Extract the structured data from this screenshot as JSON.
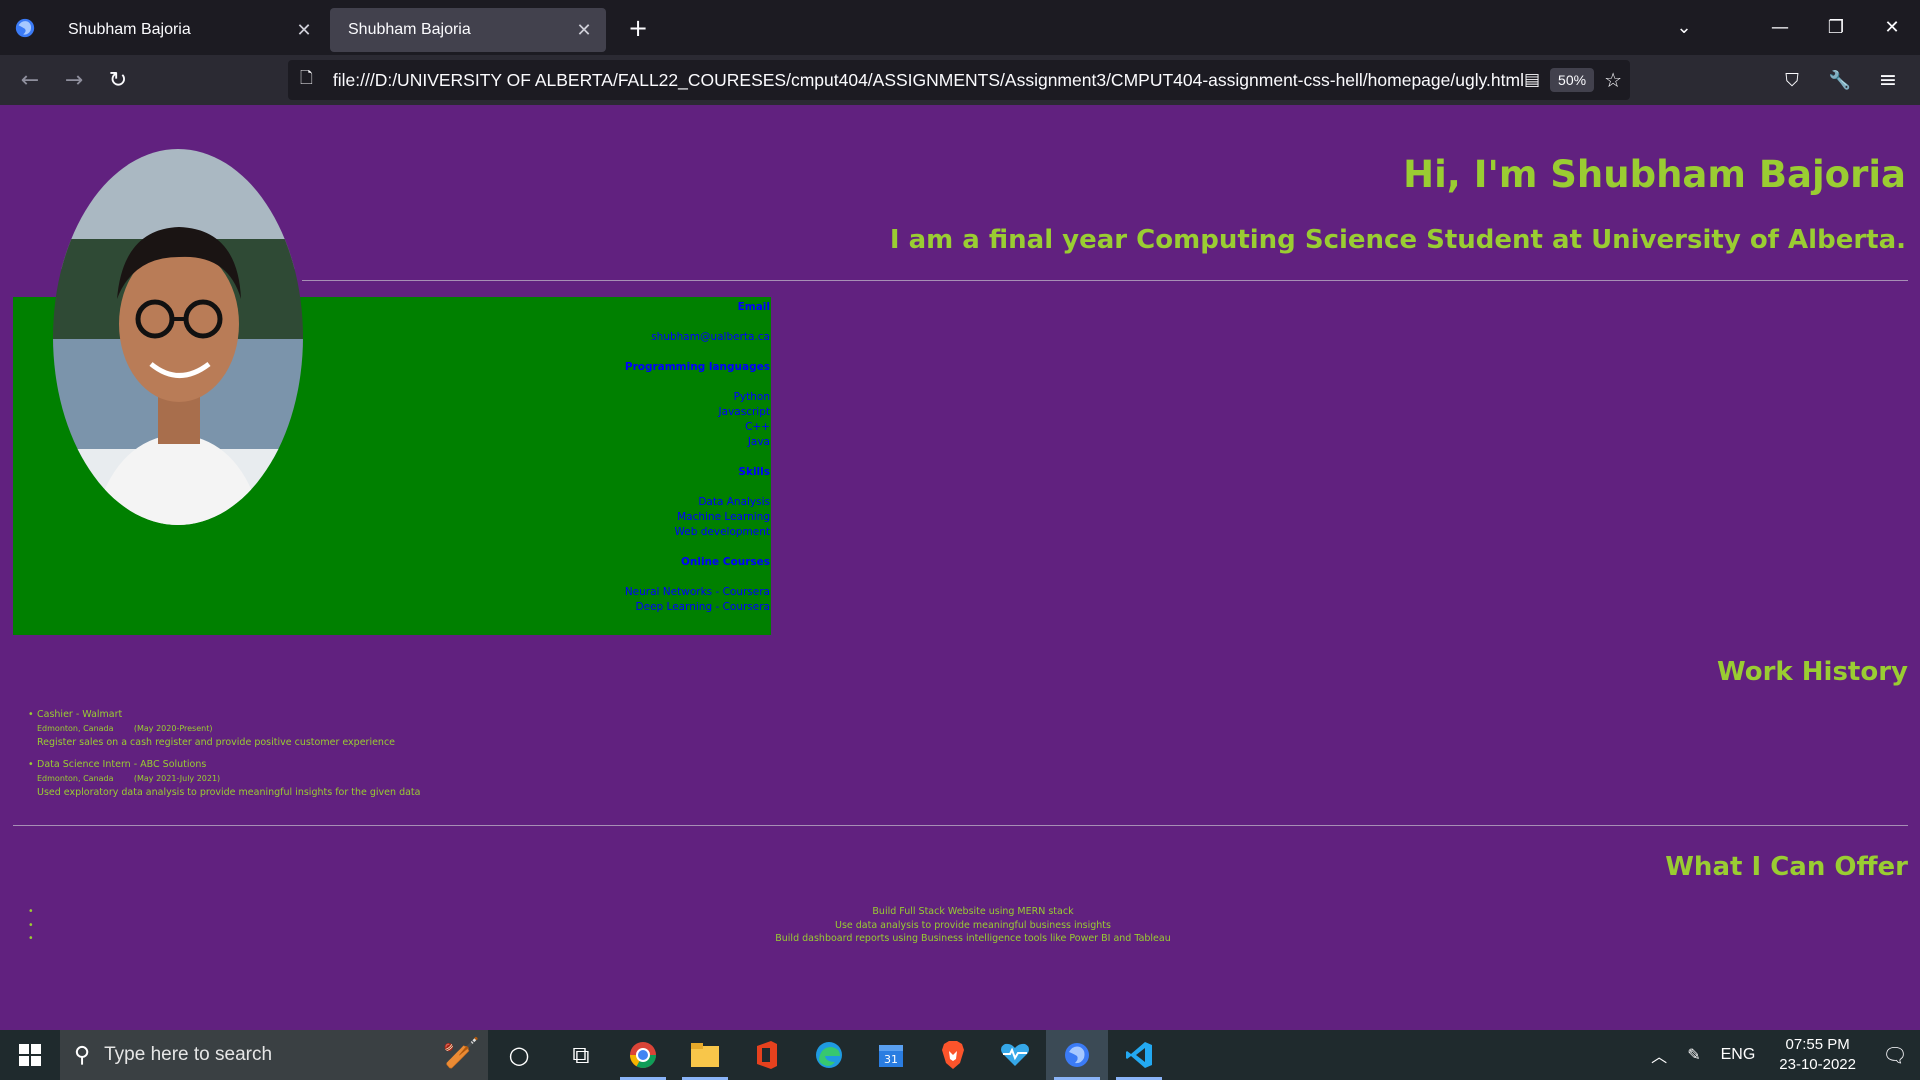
{
  "browser": {
    "tabs": [
      {
        "title": "Shubham Bajoria",
        "active": false
      },
      {
        "title": "Shubham Bajoria",
        "active": true
      }
    ],
    "url": "file:///D:/UNIVERSITY OF ALBERTA/FALL22_COURESES/cmput404/ASSIGNMENTS/Assignment3/CMPUT404-assignment-css-hell/homepage/ugly.html",
    "zoom": "50%",
    "icons": [
      "firefox-logo-icon",
      "back-icon",
      "forward-icon",
      "reload-icon",
      "page-icon",
      "reader-mode-icon",
      "bookmark-star-icon",
      "pocket-icon",
      "wrench-icon",
      "menu-icon",
      "list-all-tabs-icon",
      "minimize-icon",
      "restore-icon",
      "close-icon"
    ]
  },
  "page": {
    "background": "#61217f",
    "accent": "#9acd32",
    "info_box_bg": "#008000",
    "info_text": "#0000ff",
    "title": "Hi, I'm Shubham Bajoria",
    "subtitle": "I am a final year Computing Science Student at University of Alberta.",
    "info": {
      "email_heading": "Email",
      "email": "shubham@ualberta.ca",
      "languages_heading": "Programming languages",
      "languages": [
        "Python",
        "Javascript",
        "C++",
        "Java"
      ],
      "skills_heading": "Skills",
      "skills": [
        "Data Analysis",
        "Machine Learning",
        "Web development"
      ],
      "courses_heading": "Online Courses",
      "courses": [
        "Neural Networks - Coursera",
        "Deep Learning - Coursera"
      ]
    },
    "work_heading": "Work History",
    "jobs": [
      {
        "title": "Cashier - Walmart",
        "location": "Edmonton, Canada",
        "dates": "(May 2020-Present)",
        "description": "Register sales on a cash register and provide positive customer experience"
      },
      {
        "title": "Data Science Intern - ABC Solutions",
        "location": "Edmonton, Canada",
        "dates": "(May 2021-July 2021)",
        "description": "Used exploratory data analysis to provide meaningful insights for the given data"
      }
    ],
    "offer_heading": "What I Can Offer",
    "offers": [
      "Build Full Stack Website using MERN stack",
      "Use data analysis to provide meaningful business insights",
      "Build dashboard reports using Business intelligence tools like Power BI and Tableau"
    ]
  },
  "taskbar": {
    "search_placeholder": "Type here to search",
    "apps": [
      "cortana-icon",
      "task-view-icon",
      "chrome-icon",
      "file-explorer-icon",
      "office-icon",
      "edge-icon",
      "calendar-icon",
      "brave-icon",
      "health-app-icon",
      "firefox-icon",
      "vscode-icon"
    ],
    "language": "ENG",
    "time": "07:55 PM",
    "date": "23-10-2022"
  }
}
